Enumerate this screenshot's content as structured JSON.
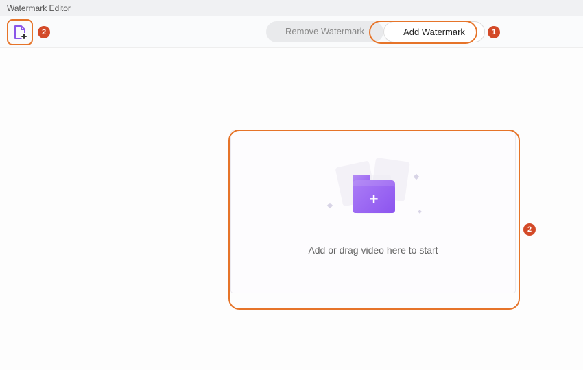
{
  "window": {
    "title": "Watermark Editor"
  },
  "toolbar": {
    "add_file_icon": "add-file-icon",
    "tabs": {
      "remove": "Remove Watermark",
      "add": "Add Watermark"
    }
  },
  "dropzone": {
    "message": "Add or drag video here to start"
  },
  "annotations": {
    "step1": "1",
    "step2": "2"
  }
}
